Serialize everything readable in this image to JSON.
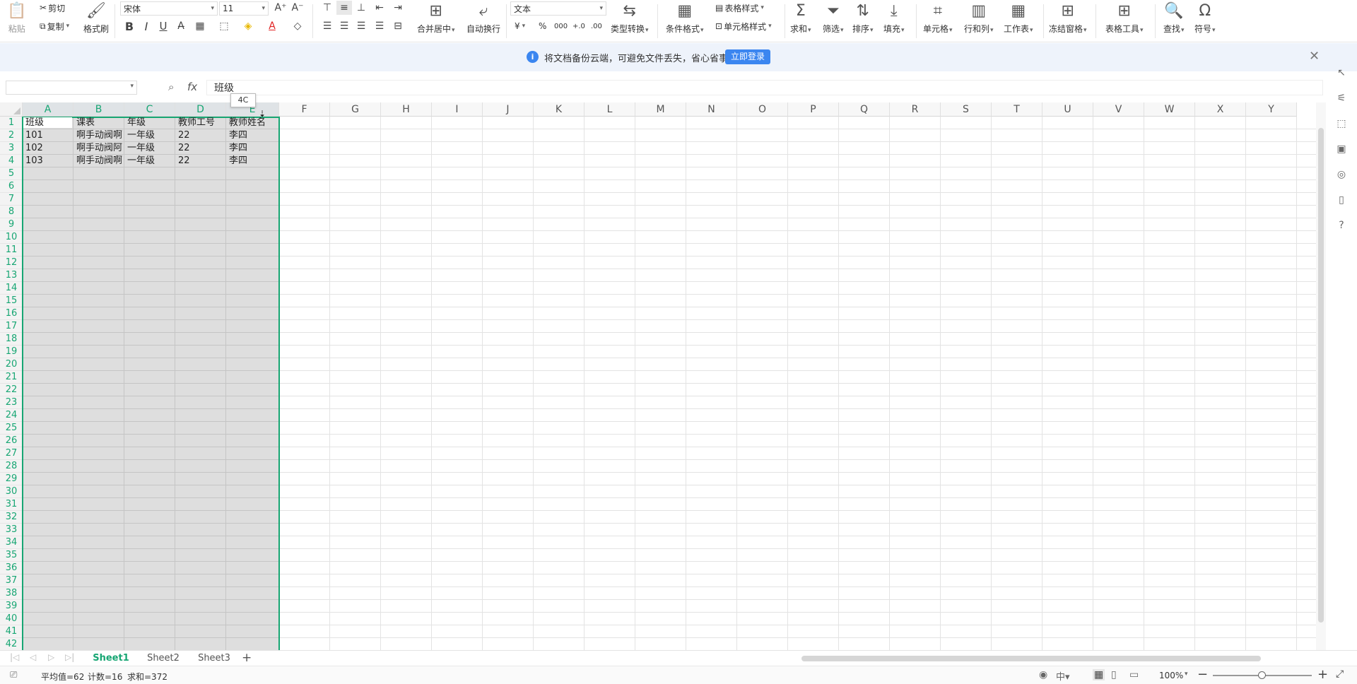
{
  "ribbon": {
    "paste": "粘贴",
    "cut": "剪切",
    "copy": "复制",
    "format_painter": "格式刷",
    "font_name": "宋体",
    "font_size": "11",
    "bold": "B",
    "italic": "I",
    "underline": "U",
    "merge_center": "合并居中",
    "auto_wrap": "自动换行",
    "number_format": "文本",
    "currency": "¥",
    "percent": "%",
    "thousands": "000",
    "inc_decimal": "+.0",
    "dec_decimal": ".00",
    "type_convert": "类型转换",
    "conditional_format": "条件格式",
    "table_style": "表格样式",
    "cell_style": "单元格样式",
    "sum": "求和",
    "filter": "筛选",
    "sort": "排序",
    "fill": "填充",
    "cell": "单元格",
    "row_col": "行和列",
    "worksheet": "工作表",
    "freeze": "冻结窗格",
    "table_tools": "表格工具",
    "find": "查找",
    "symbol": "符号"
  },
  "notice": {
    "text": "将文档备份云端，可避免文件丢失，省心省事",
    "login_button": "立即登录"
  },
  "formula_bar": {
    "name_box": "",
    "fx": "fx",
    "content": "班级",
    "tooltip": "4C"
  },
  "grid": {
    "columns": [
      "A",
      "B",
      "C",
      "D",
      "E",
      "F",
      "G",
      "H",
      "I",
      "J",
      "K",
      "L",
      "M",
      "N",
      "O",
      "P",
      "Q",
      "R",
      "S",
      "T",
      "U",
      "V",
      "W",
      "X",
      "Y"
    ],
    "selected_columns": [
      "A",
      "B",
      "C",
      "D",
      "E"
    ],
    "rows": [
      "1",
      "2",
      "3",
      "4",
      "5",
      "6",
      "7",
      "8",
      "9",
      "10",
      "11",
      "12",
      "13",
      "14",
      "15",
      "16",
      "17",
      "18",
      "19",
      "20",
      "21",
      "22",
      "23",
      "24",
      "25",
      "26",
      "27",
      "28",
      "29",
      "30",
      "31",
      "32",
      "33",
      "34",
      "35",
      "36",
      "37",
      "38",
      "39",
      "40",
      "41",
      "42"
    ],
    "data": [
      [
        "班级",
        "课表",
        "年级",
        "教师工号",
        "教师姓名"
      ],
      [
        "101",
        "啊手动阀啊",
        "一年级",
        "22",
        "李四"
      ],
      [
        "102",
        "啊手动阀阿",
        "一年级",
        "22",
        "李四"
      ],
      [
        "103",
        "啊手动阀啊",
        "一年级",
        "22",
        "李四"
      ]
    ]
  },
  "tabs": {
    "sheets": [
      "Sheet1",
      "Sheet2",
      "Sheet3"
    ],
    "active": "Sheet1",
    "add": "+"
  },
  "status": {
    "average": "平均值=62",
    "count": "计数=16",
    "sum": "求和=372",
    "zoom": "100%"
  },
  "colors": {
    "accent": "#17a673",
    "primary_button": "#3b86f0"
  }
}
